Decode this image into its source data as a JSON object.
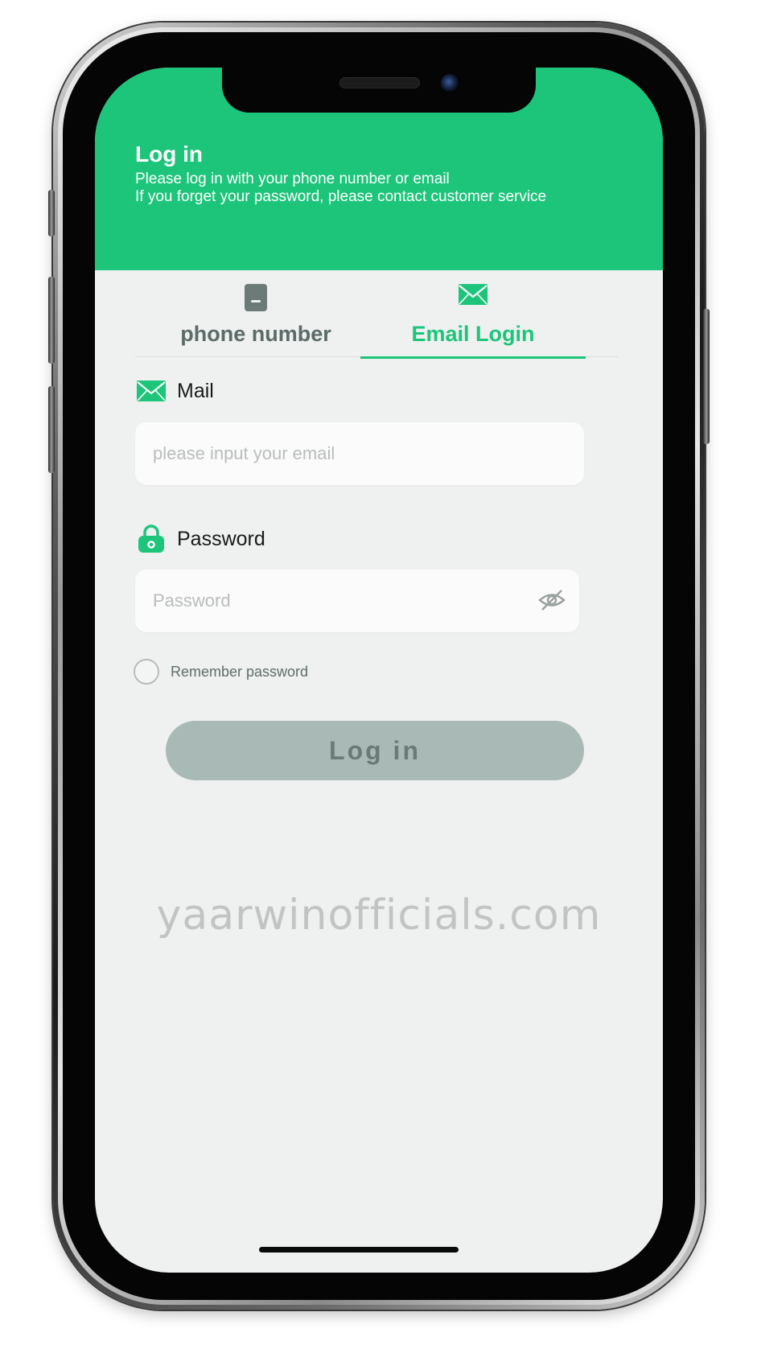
{
  "header": {
    "title": "Log in",
    "line1": "Please log in with your phone number or email",
    "line2": "If you forget your password, please contact customer service"
  },
  "tabs": [
    {
      "label": "phone number",
      "icon": "phone-icon",
      "active": false
    },
    {
      "label": "Email Login",
      "icon": "envelope-icon",
      "active": true
    }
  ],
  "form": {
    "mail_label": "Mail",
    "mail_placeholder": "please input your email",
    "password_label": "Password",
    "password_placeholder": "Password",
    "remember_label": "Remember password",
    "login_label": "Log in"
  },
  "watermark": "yaarwinofficials.com",
  "colors": {
    "accent": "#1dc57b",
    "button_disabled": "#a9bab6",
    "screen_bg": "#eff0f0"
  }
}
